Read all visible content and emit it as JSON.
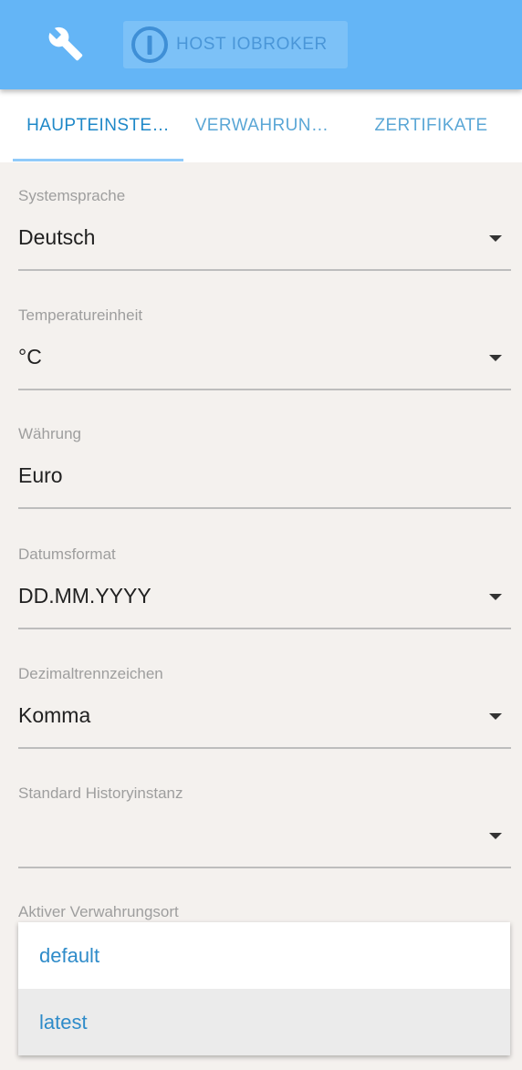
{
  "header": {
    "host_label": "HOST IOBROKER",
    "wrench_icon": "wrench-icon",
    "logo_icon": "iobroker-logo-icon"
  },
  "tabs": [
    {
      "label": "HAUPTEINSTE…",
      "active": true
    },
    {
      "label": "VERWAHRUN…",
      "active": false
    },
    {
      "label": "ZERTIFIKATE",
      "active": false
    }
  ],
  "fields": [
    {
      "label": "Systemsprache",
      "value": "Deutsch",
      "type": "select"
    },
    {
      "label": "Temperatureinheit",
      "value": "°C",
      "type": "select"
    },
    {
      "label": "Währung",
      "value": "Euro",
      "type": "text"
    },
    {
      "label": "Datumsformat",
      "value": "DD.MM.YYYY",
      "type": "select"
    },
    {
      "label": "Dezimaltrennzeichen",
      "value": "Komma",
      "type": "select"
    },
    {
      "label": "Standard Historyinstanz",
      "value": "",
      "type": "select"
    },
    {
      "label": "Aktiver Verwahrungsort",
      "value": "",
      "type": "select"
    }
  ],
  "dropdown": {
    "options": [
      "default",
      "latest"
    ],
    "highlighted_index": 1
  },
  "colors": {
    "appbar": "#64b5f6",
    "tab_active": "#1e88c8",
    "tab_inactive": "#5ba7d6",
    "option_text": "#2e8bc9",
    "background": "#f4f1ee"
  }
}
